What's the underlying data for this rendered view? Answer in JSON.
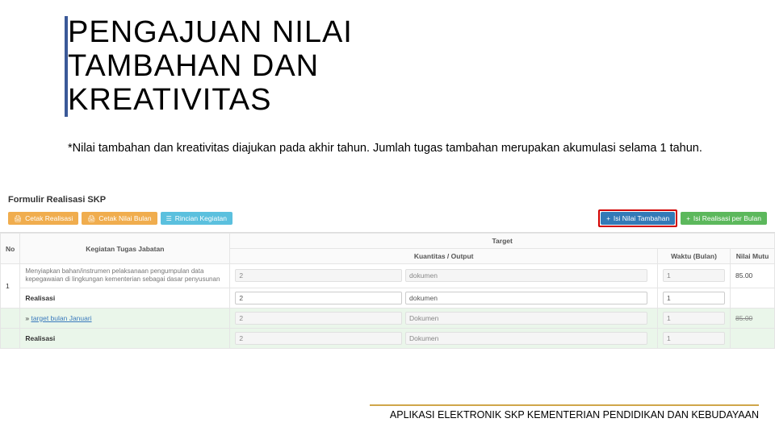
{
  "title": {
    "line1": "PENGAJUAN NILAI",
    "line2": "TAMBAHAN DAN",
    "line3": "KREATIVITAS"
  },
  "note": "*Nilai tambahan dan kreativitas diajukan pada akhir tahun. Jumlah tugas tambahan merupakan akumulasi selama 1 tahun.",
  "panel": {
    "heading": "Formulir Realisasi SKP",
    "buttons": {
      "cetak_realisasi": "Cetak Realisasi",
      "cetak_nilai_bulan": "Cetak Nilai Bulan",
      "rincian_kegiatan": "Rincian Kegiatan",
      "isi_nilai_tambahan": "Isi Nilai Tambahan",
      "isi_realisasi_bulan": "Isi Realisasi per Bulan"
    },
    "headers": {
      "no": "No",
      "kegiatan": "Kegiatan Tugas Jabatan",
      "target": "Target",
      "kuantitas": "Kuantitas / Output",
      "waktu": "Waktu (Bulan)",
      "nilai": "Nilai Mutu"
    },
    "rows": {
      "r1": {
        "no": "1",
        "desc": "Menyiapkan bahan/instrumen pelaksanaan pengumpulan data kepegawaian di lingkungan kementerian sebagai dasar penyusunan",
        "qty": "2",
        "unit": "dokumen",
        "waktu": "1",
        "nilai": "85.00"
      },
      "realisasi_label": "Realisasi",
      "r1real": {
        "qty": "2",
        "unit": "dokumen",
        "waktu": "1"
      },
      "r2": {
        "link": "target bulan Januari",
        "bullet": "»",
        "qty": "2",
        "unit": "Dokumen",
        "waktu": "1",
        "nilai": "85.00"
      },
      "r2real": {
        "qty": "2",
        "unit": "Dokumen",
        "waktu": "1"
      }
    }
  },
  "footer": "APLIKASI ELEKTRONIK SKP KEMENTERIAN PENDIDIKAN DAN KEBUDAYAAN"
}
